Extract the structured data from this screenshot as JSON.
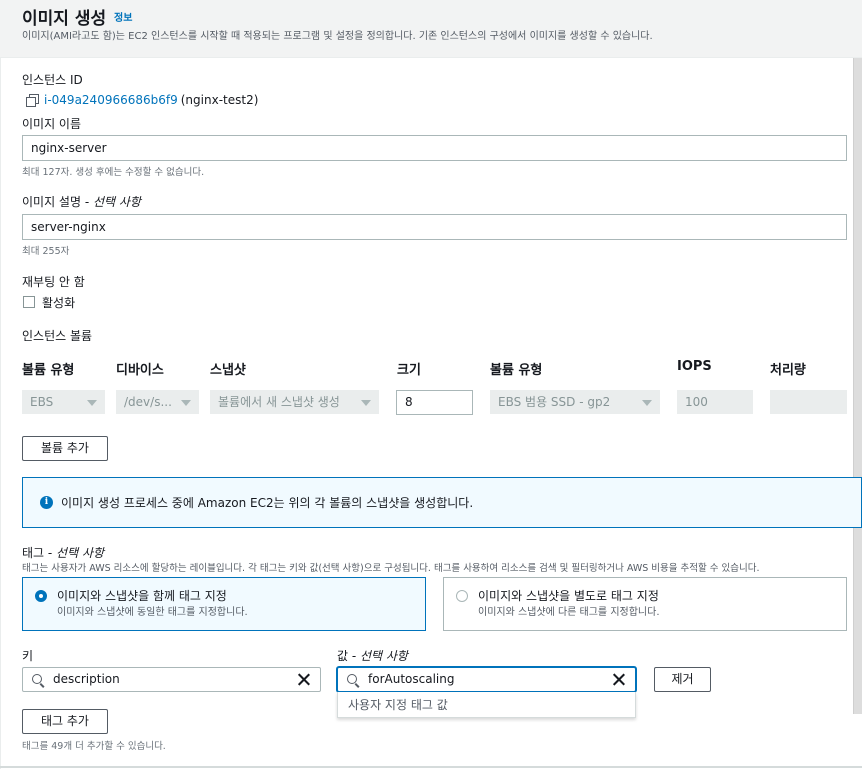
{
  "header": {
    "title": "이미지 생성",
    "info_link": "정보",
    "description": "이미지(AMI라고도 함)는 EC2 인스턴스를 시작할 때 적용되는 프로그램 및 설정을 정의합니다. 기존 인스턴스의 구성에서 이미지를 생성할 수 있습니다."
  },
  "instance": {
    "label": "인스턴스 ID",
    "id": "i-049a240966686b6f9",
    "name": "(nginx-test2)"
  },
  "image_name": {
    "label": "이미지 이름",
    "value": "nginx-server",
    "hint": "최대 127자. 생성 후에는 수정할 수 없습니다."
  },
  "image_description": {
    "label": "이미지 설명 - ",
    "label_optional": "선택 사항",
    "value": "server-nginx",
    "hint": "최대 255자"
  },
  "no_reboot": {
    "label": "재부팅 안 함",
    "checkbox_label": "활성화",
    "checked": false
  },
  "volumes": {
    "section_label": "인스턴스 볼륨",
    "columns": [
      "볼륨 유형",
      "디바이스",
      "스냅샷",
      "크기",
      "볼륨 유형",
      "IOPS",
      "처리량"
    ],
    "row": {
      "volume_type": "EBS",
      "device": "/dev/s...",
      "snapshot": "볼륨에서 새 스냅샷 생성",
      "size": "8",
      "ebs_type": "EBS 범용 SSD - gp2",
      "iops": "100",
      "throughput": ""
    },
    "add_button": "볼륨 추가"
  },
  "info_alert": {
    "icon": "info-icon",
    "text": "이미지 생성 프로세스 중에 Amazon EC2는 위의 각 볼륨의 스냅샷을 생성합니다."
  },
  "tags": {
    "label": "태그 - ",
    "label_optional": "선택 사항",
    "description": "태그는 사용자가 AWS 리소스에 할당하는 레이블입니다. 각 태그는 키와 값(선택 사항)으로 구성됩니다. 태그를 사용하여 리소스를 검색 및 필터링하거나 AWS 비용을 추적할 수 있습니다.",
    "options": [
      {
        "title": "이미지와 스냅샷을 함께 태그 지정",
        "desc": "이미지와 스냅샷에 동일한 태그를 지정합니다.",
        "selected": true
      },
      {
        "title": "이미지와 스냅샷을 별도로 태그 지정",
        "desc": "이미지와 스냅샷에 다른 태그를 지정합니다.",
        "selected": false
      }
    ],
    "key_label": "키",
    "value_label": "값 - ",
    "value_label_optional": "선택 사항",
    "key_value": "description",
    "value_value": "forAutoscaling",
    "remove_button": "제거",
    "dropdown_option": "사용자 지정 태그 값",
    "add_button": "태그 추가",
    "remaining_hint": "태그를 49개 더 추가할 수 있습니다."
  },
  "colors": {
    "accent": "#0073bb",
    "header_bg": "#f2f3f3",
    "disabled_bg": "#eaeded"
  }
}
